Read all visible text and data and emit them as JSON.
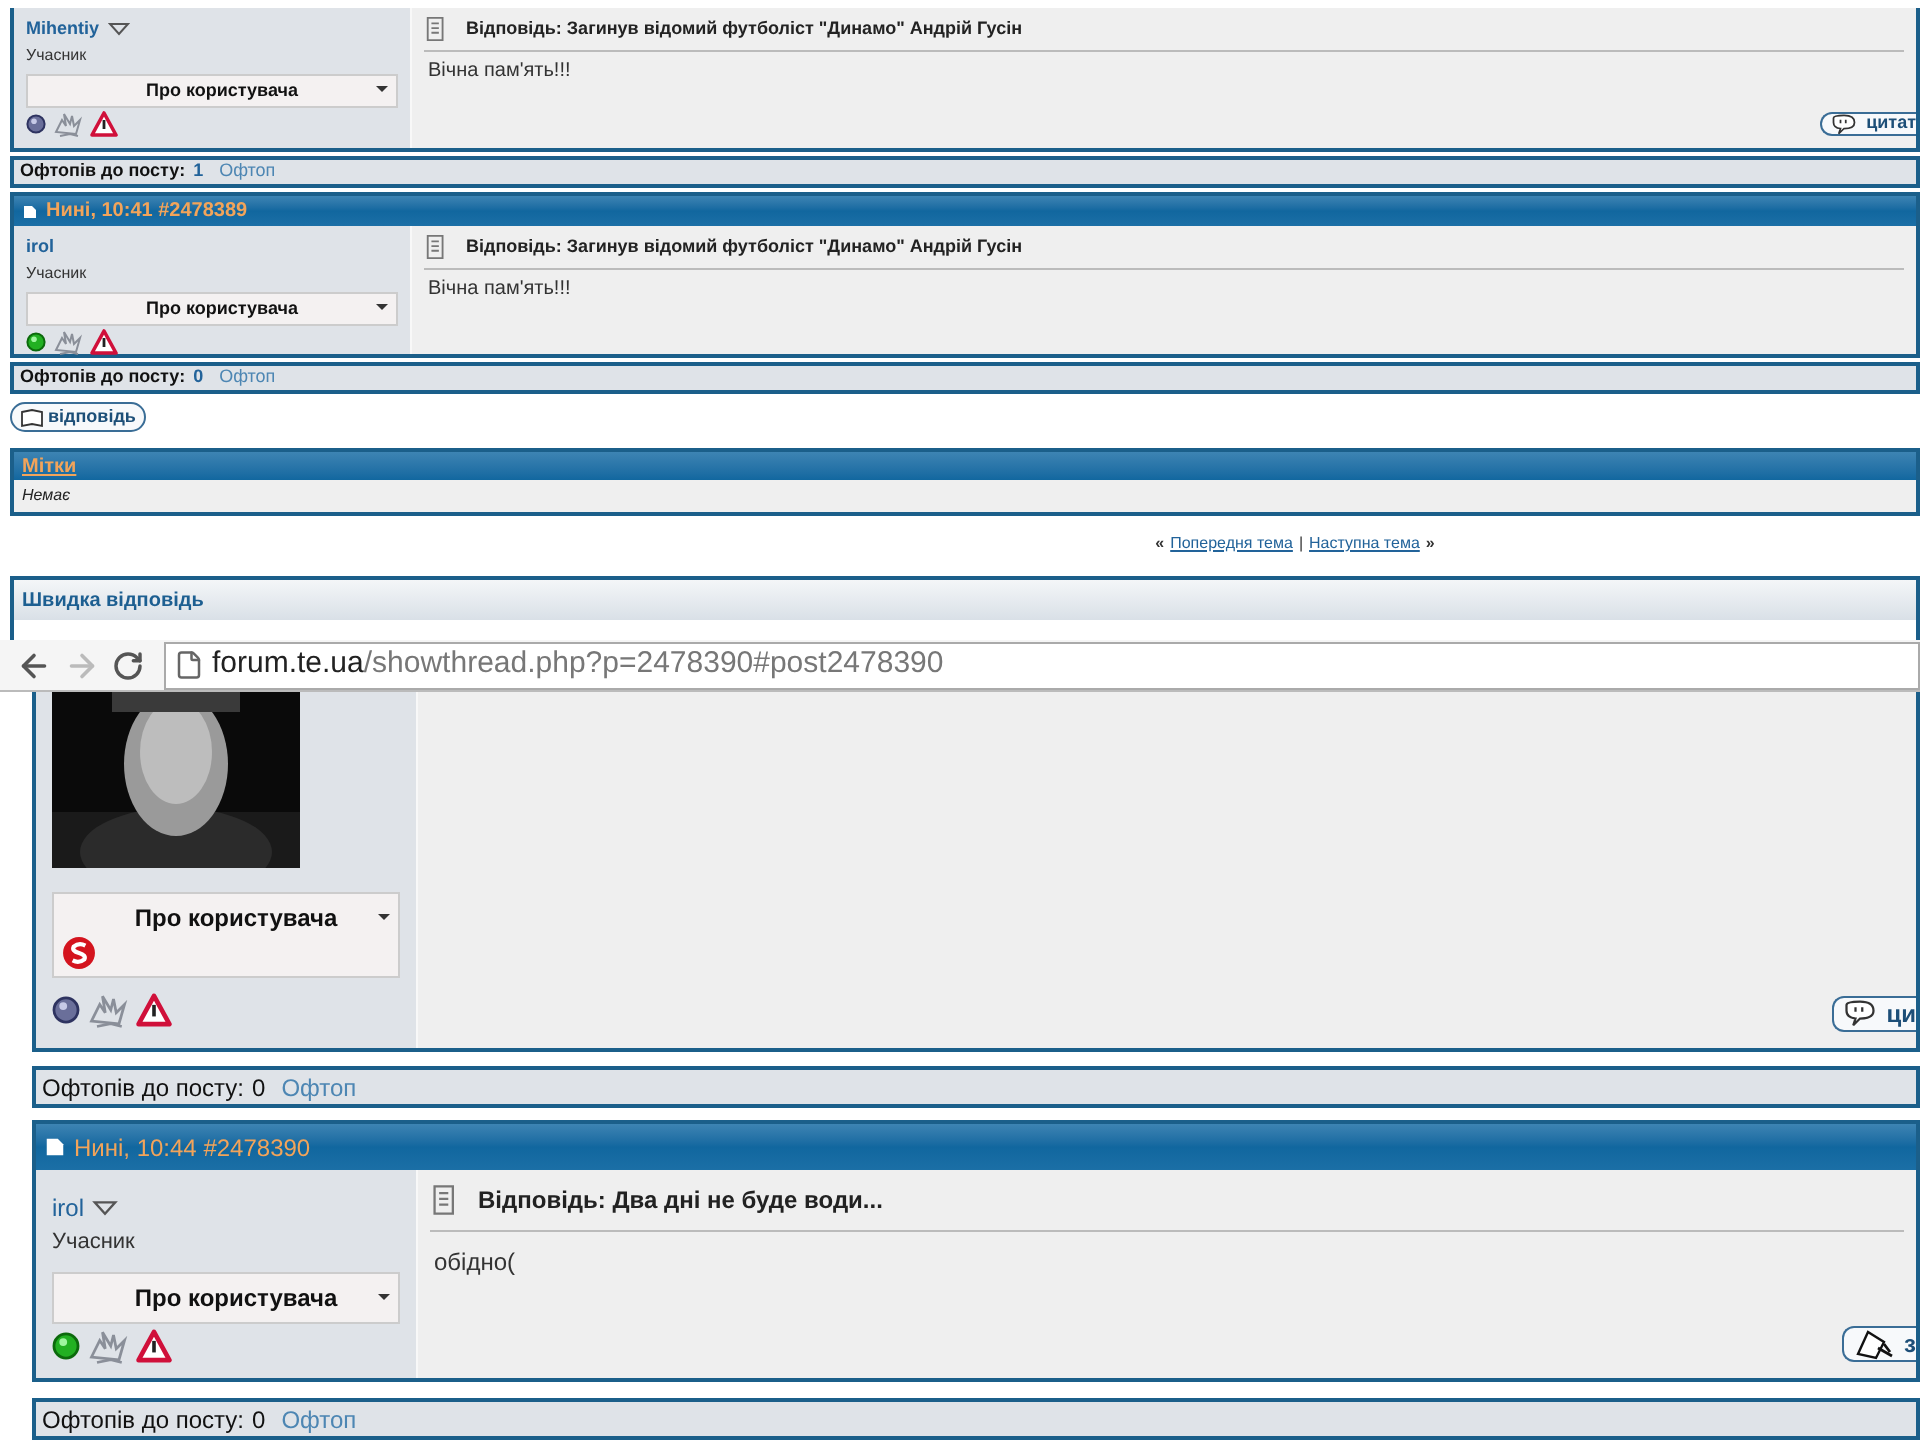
{
  "top_page": {
    "posts": [
      {
        "username": "Mihentiy",
        "has_menu": true,
        "rank": "Учасник",
        "profile_menu": "Про користувача",
        "online": false,
        "title": "Відповідь: Загинув відомий футболіст \"Динамо\" Андрій Гусін",
        "message": "Вічна пам'ять!!!",
        "action_button": {
          "kind": "quote",
          "label": "цитат"
        }
      },
      {
        "header": "Нині, 10:41 #2478389",
        "username": "irol",
        "has_menu": false,
        "rank": "Учасник",
        "profile_menu": "Про користувача",
        "online": true,
        "title": "Відповідь: Загинув відомий футболіст \"Динамо\" Андрій Гусін",
        "message": "Вічна пам'ять!!!"
      }
    ],
    "offtopic_bars": [
      {
        "label": "Офтопів до посту:",
        "count": "1",
        "link": "Офтоп"
      },
      {
        "label": "Офтопів до посту:",
        "count": "0",
        "link": "Офтоп"
      }
    ],
    "reply_button": "відповідь",
    "tags_panel": {
      "title": "Мітки",
      "body": "Немає"
    },
    "thread_nav": {
      "open": "«",
      "previous": "Попередня тема",
      "separator": "|",
      "next": "Наступна тема",
      "close": "»"
    },
    "quick_reply": {
      "title": "Швидка відповідь"
    }
  },
  "browser": {
    "domain": "forum.te.ua",
    "path": "/showthread.php?p=2478390#post2478390"
  },
  "bottom_page": {
    "posts": [
      {
        "avatar": true,
        "profile_menu": "Про користувача",
        "skype": true,
        "online": false,
        "action_button": {
          "kind": "quote",
          "label": "ци"
        }
      },
      {
        "header": "Нині, 10:44 #2478390",
        "username": "irol",
        "has_menu": true,
        "rank": "Учасник",
        "profile_menu": "Про користувача",
        "online": true,
        "title": "Відповідь: Два дні не буде води...",
        "message": "обідно(",
        "action_button": {
          "kind": "edit",
          "label": "з"
        }
      }
    ],
    "offtopic_bars": [
      {
        "label": "Офтопів до посту:",
        "count": "0",
        "link": "Офтоп"
      },
      {
        "label": "Офтопів до посту:",
        "count": "0",
        "link": "Офтоп"
      }
    ]
  }
}
